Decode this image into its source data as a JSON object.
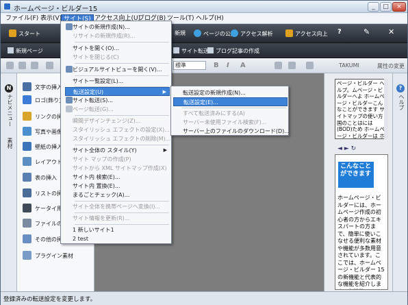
{
  "window": {
    "title": "ホームページ・ビルダー15",
    "controls": {
      "minimize": "_",
      "maximize": "□",
      "close": "×"
    }
  },
  "menubar": {
    "items": [
      "ファイル(F)",
      "表示(V)",
      "サイト(S)",
      "アクセス向上(U)",
      "ブログ(B)",
      "ツール(T)",
      "ヘルプ(H)"
    ]
  },
  "toolbar1": {
    "items": [
      "スタート",
      "ページの公開",
      "アクセス解析",
      "アクセス向上"
    ],
    "partial": "新規"
  },
  "toolbar2": {
    "items": [
      "新規ページ",
      "サイト転送",
      "ブログ記事の作成"
    ]
  },
  "toolbar3": {
    "font_value": "標準",
    "format_buttons": [
      "B",
      "I",
      "A"
    ],
    "takumi": "TAKUMI",
    "right_label": "属性の変更"
  },
  "left_vertical_tabs": [
    "ナビメニュー",
    "素材"
  ],
  "left_panel": {
    "items": [
      {
        "label": "文字の挿入",
        "icon": "text-icon",
        "color": "#4a6fa5"
      },
      {
        "label": "ロゴ(飾り文字",
        "icon": "logo-icon",
        "color": "#3c7bd6"
      },
      {
        "label": "リンクの挿入",
        "icon": "link-icon",
        "color": "#d8a42a"
      },
      {
        "label": "写真や画像の",
        "icon": "photo-icon",
        "color": "#4b8fd0"
      },
      {
        "label": "壁紙の挿入",
        "icon": "wallpaper-icon",
        "color": "#3b74b8"
      },
      {
        "label": "レイアウト部品",
        "icon": "layout-icon",
        "color": "#5c8ec4"
      },
      {
        "label": "表の挿入",
        "icon": "table-icon",
        "color": "#5a7fb0"
      },
      {
        "label": "リストの挿入",
        "icon": "list-icon",
        "color": "#4a6a98"
      },
      {
        "label": "ケータイ用部品",
        "icon": "mobile-icon",
        "color": "#404a58"
      },
      {
        "label": "ファイルの挿入",
        "icon": "file-icon",
        "color": "#7a8aa0"
      },
      {
        "label": "その他の挿入",
        "icon": "other-icon",
        "color": "#6a8ec2"
      },
      {
        "label": "プラグイン素材",
        "icon": "plugin-icon",
        "color": "#7a9ac8"
      }
    ]
  },
  "site_menu": {
    "items": [
      {
        "label": "サイトの新規作成(N)...",
        "disabled": false,
        "icon": true
      },
      {
        "label": "リサイトの新規作成(R)...",
        "disabled": true
      },
      {
        "sep": true
      },
      {
        "label": "サイトを開く(O)...",
        "disabled": false
      },
      {
        "label": "サイトを閉じる(C)",
        "disabled": true
      },
      {
        "sep": true
      },
      {
        "label": "ビジュアルサイトビューを開く(V)...",
        "disabled": false,
        "icon": true
      },
      {
        "sep": true
      },
      {
        "label": "サイト一覧設定(L)...",
        "disabled": false
      },
      {
        "sep": true
      },
      {
        "label": "転送設定(U)",
        "disabled": false,
        "submenu": true,
        "highlighted": true
      },
      {
        "label": "サイト転送(S)...",
        "disabled": false,
        "icon": true
      },
      {
        "label": "ページ転送(G)...",
        "disabled": true,
        "icon": true
      },
      {
        "sep": true
      },
      {
        "label": "瞬間デザインチェンジ(Z)...",
        "disabled": true
      },
      {
        "label": "スタイリッシュ エフェクトの設定(X)...",
        "disabled": true
      },
      {
        "label": "スタイリッシュ エフェクトの削除(M)...",
        "disabled": true
      },
      {
        "sep": true
      },
      {
        "label": "サイト全体の スタイル(Y)",
        "disabled": false,
        "submenu": true
      },
      {
        "label": "サイト マップの作成(P)",
        "disabled": true
      },
      {
        "label": "サイトから XML サイトマップ作成(X)",
        "disabled": true
      },
      {
        "label": "サイト内 検索(E)...",
        "disabled": false
      },
      {
        "label": "サイト内 置換(E)...",
        "disabled": false
      },
      {
        "label": "まるごとチェック(A)...",
        "disabled": false
      },
      {
        "sep": true
      },
      {
        "label": "サイト全体を携帯ページへ変換(I)...",
        "disabled": true
      },
      {
        "sep": true
      },
      {
        "label": "サイト情報を更新(R)...",
        "disabled": true
      },
      {
        "sep": true
      },
      {
        "label": "1 新しいサイト1",
        "disabled": false
      },
      {
        "label": "2 test",
        "disabled": false
      }
    ]
  },
  "transfer_submenu": {
    "items": [
      {
        "label": "転送設定の新規作成(N)...",
        "disabled": false
      },
      {
        "label": "転送設定(E)...",
        "disabled": false,
        "highlighted": true
      },
      {
        "sep": true
      },
      {
        "label": "すべて転送済みにする(A)",
        "disabled": true
      },
      {
        "label": "サーバー未使用ファイル検索(F)...",
        "disabled": true
      },
      {
        "label": "サーバー上のファイルのダウンロード(D)...",
        "disabled": false
      }
    ]
  },
  "help_panel": {
    "text": "ページ・ビルダー ヘルプ。ムページ・ビルダーへよ ホームページ・ビルダーこんなことができます サイトマップの使い方 国のことはには (BOD)ため ホームページ・ビルダーは ホームページのまとめらに しあげた使いかたになるように 面白、基本操作で"
  },
  "browser_nav": {
    "back": "◄",
    "forward": "►",
    "refresh": "↻"
  },
  "browser": {
    "heading": "こんなことができます",
    "body": "ホームページ・ビルダーには、ホームページ作成の初心者の方からエキスパートの方まで、簡単に使いこなせる便利な素材や機能が多数用意されています。ここでは、ホームページ・ビルダー 15の新機能と代表的な機能を紹介します。各機能"
  },
  "right_vertical_tabs": [
    "ヘルプ"
  ],
  "statusbar": {
    "text": "登録済みの転送設定を変更します。"
  }
}
